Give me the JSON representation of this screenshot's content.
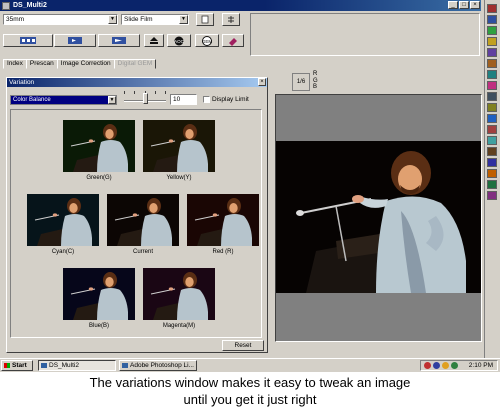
{
  "window": {
    "title": "DS_Multi2"
  },
  "toolbar": {
    "film_size": "35mm",
    "film_type": "Slide Film"
  },
  "tabs": [
    {
      "label": "Index"
    },
    {
      "label": "Prescan"
    },
    {
      "label": "Image Correction"
    },
    {
      "label": "Digital GEM"
    }
  ],
  "variation": {
    "title": "Variation",
    "mode": "Color Balance",
    "amount": "10",
    "display_limit_label": "Display Limit",
    "reset_label": "Reset",
    "thumbnails": [
      {
        "label": "Green(G)"
      },
      {
        "label": "Yellow(Y)"
      },
      {
        "label": "Cyan(C)"
      },
      {
        "label": "Current"
      },
      {
        "label": "Red (R)"
      },
      {
        "label": "Blue(B)"
      },
      {
        "label": "Magenta(M)"
      }
    ]
  },
  "preview": {
    "frame_counter": "1/6",
    "channels": [
      "R",
      "G",
      "B"
    ]
  },
  "taskbar": {
    "start_label": "Start",
    "tasks": [
      "DS_Multi2",
      "Adobe Photoshop Li..."
    ],
    "clock": "2:10 PM"
  },
  "caption": {
    "line1": "The variations window makes it easy to tweak an image",
    "line2": "until you get it just right"
  }
}
